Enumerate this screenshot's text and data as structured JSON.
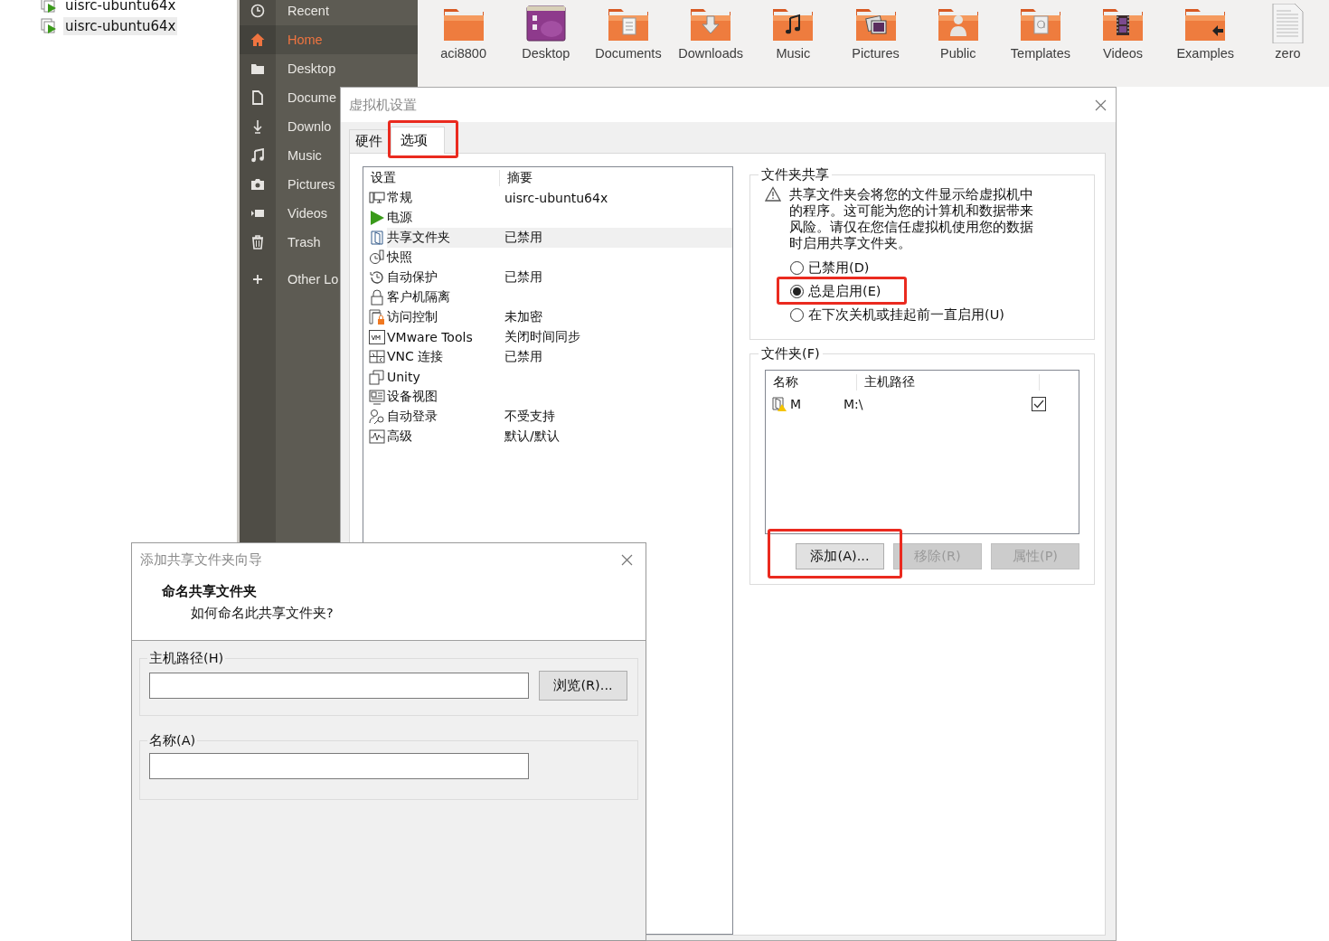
{
  "explorer_tree": {
    "items": [
      {
        "label": "uisrc-ubuntu64x",
        "selected": false
      },
      {
        "label": "uisrc-ubuntu64x",
        "selected": true
      }
    ]
  },
  "file_manager": {
    "sidebar": [
      {
        "kind": "recent",
        "label": "Recent",
        "selected": false
      },
      {
        "kind": "home",
        "label": "Home",
        "selected": true
      },
      {
        "kind": "desktop",
        "label": "Desktop",
        "selected": false
      },
      {
        "kind": "documents",
        "label": "Docume",
        "selected": false
      },
      {
        "kind": "downloads",
        "label": "Downlo",
        "selected": false
      },
      {
        "kind": "music",
        "label": "Music",
        "selected": false
      },
      {
        "kind": "pictures",
        "label": "Pictures",
        "selected": false
      },
      {
        "kind": "videos",
        "label": "Videos",
        "selected": false
      },
      {
        "kind": "trash",
        "label": "Trash",
        "selected": false
      },
      {
        "kind": "other",
        "label": "Other Lo",
        "selected": false
      }
    ],
    "files": [
      {
        "kind": "folder",
        "label": "aci8800"
      },
      {
        "kind": "desktop",
        "label": "Desktop"
      },
      {
        "kind": "documents",
        "label": "Documents"
      },
      {
        "kind": "downloads",
        "label": "Downloads"
      },
      {
        "kind": "music",
        "label": "Music"
      },
      {
        "kind": "pictures",
        "label": "Pictures"
      },
      {
        "kind": "public",
        "label": "Public"
      },
      {
        "kind": "templates",
        "label": "Templates"
      },
      {
        "kind": "videos",
        "label": "Videos"
      },
      {
        "kind": "examples",
        "label": "Examples"
      },
      {
        "kind": "file",
        "label": "zero"
      }
    ]
  },
  "vm_settings": {
    "title": "虚拟机设置",
    "tabs": [
      {
        "label": "硬件",
        "selected": false,
        "highlighted": false
      },
      {
        "label": "选项",
        "selected": true,
        "highlighted": true
      }
    ],
    "settings_table": {
      "columns": [
        "设置",
        "摘要"
      ],
      "rows": [
        {
          "kind": "general",
          "setting": "常规",
          "summary": "uisrc-ubuntu64x",
          "selected": false
        },
        {
          "kind": "power",
          "setting": "电源",
          "selected": false
        },
        {
          "kind": "shared",
          "setting": "共享文件夹",
          "summary": "已禁用",
          "selected": true
        },
        {
          "kind": "snapshot",
          "setting": "快照",
          "selected": false
        },
        {
          "kind": "autoprotect",
          "setting": "自动保护",
          "summary": "已禁用",
          "selected": false
        },
        {
          "kind": "isolation",
          "setting": "客户机隔离",
          "selected": false
        },
        {
          "kind": "access",
          "setting": "访问控制",
          "summary": "未加密",
          "selected": false
        },
        {
          "kind": "tools",
          "setting": "VMware Tools",
          "summary": "关闭时间同步",
          "selected": false
        },
        {
          "kind": "vnc",
          "setting": "VNC 连接",
          "summary": "已禁用",
          "selected": false
        },
        {
          "kind": "unity",
          "setting": "Unity",
          "selected": false
        },
        {
          "kind": "devices",
          "setting": "设备视图",
          "selected": false
        },
        {
          "kind": "autologin",
          "setting": "自动登录",
          "summary": "不受支持",
          "selected": false
        },
        {
          "kind": "advanced",
          "setting": "高级",
          "summary": "默认/默认",
          "selected": false
        }
      ]
    },
    "sharing": {
      "title": "文件夹共享",
      "warning": "共享文件夹会将您的文件显示给虚拟机中的程序。这可能为您的计算机和数据带来风险。请仅在您信任虚拟机使用您的数据时启用共享文件夹。",
      "options": [
        {
          "label": "已禁用(D)",
          "selected": false,
          "highlighted": false
        },
        {
          "label": "总是启用(E)",
          "selected": true,
          "highlighted": true
        },
        {
          "label": "在下次关机或挂起前一直启用(U)",
          "selected": false,
          "highlighted": false
        }
      ]
    },
    "folders": {
      "title": "文件夹(F)",
      "columns": [
        "名称",
        "主机路径"
      ],
      "rows": [
        {
          "name": "M",
          "host_path": "M:\\",
          "enabled": true
        }
      ],
      "buttons": [
        {
          "label": "添加(A)...",
          "disabled": false,
          "highlighted": true
        },
        {
          "label": "移除(R)",
          "disabled": true,
          "highlighted": false
        },
        {
          "label": "属性(P)",
          "disabled": true,
          "highlighted": false
        }
      ]
    }
  },
  "add_wizard": {
    "title": "添加共享文件夹向导",
    "heading": "命名共享文件夹",
    "subheading": "如何命名此共享文件夹?",
    "host_path": {
      "label": "主机路径(H)",
      "browse_button": "浏览(R)..."
    },
    "name": {
      "label": "名称(A)"
    }
  }
}
